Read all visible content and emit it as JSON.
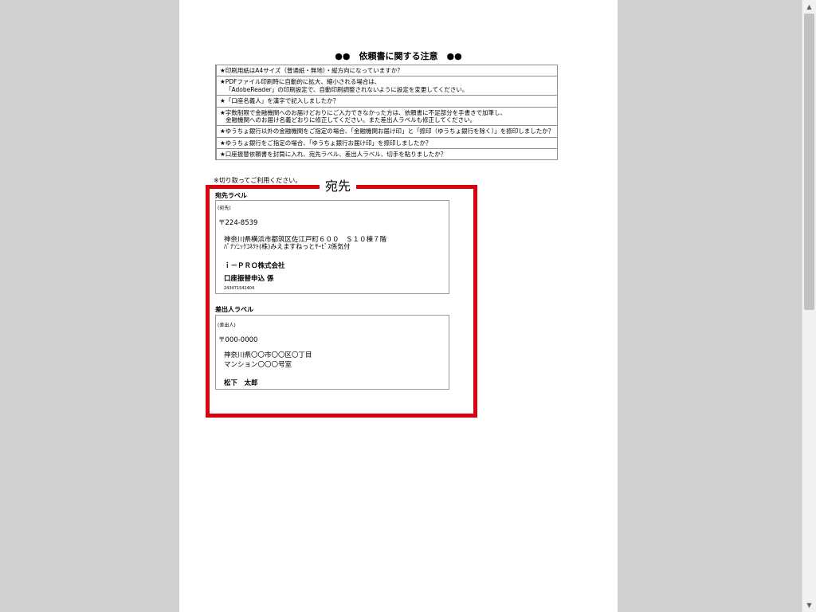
{
  "document": {
    "title": "●●　依頼書に関する注意　●●",
    "checklist": [
      [
        "★印刷用紙はA4サイズ（普通紙・無地）・縦方向になっていますか？"
      ],
      [
        "★PDFファイル印刷時に自動的に拡大、縮小される場合は、",
        "「AdobeReader」の印刷設定で、自動印刷調整されないように設定を変更してください。"
      ],
      [
        "★「口座名義人」を漢字で記入しましたか？"
      ],
      [
        "★字数制限で金融機関へのお届けどおりにご入力できなかった方は、依頼書に不足部分を手書きで加筆し、",
        "金融機関へのお届け名義どおりに修正してください。また差出人ラベルも修正してください。"
      ],
      [
        "★ゆうちょ銀行以外の金融機関をご指定の場合、「金融機関お届け印」と「捺印（ゆうちょ銀行を除く）」を捺印しましたか？"
      ],
      [
        "★ゆうちょ銀行をご指定の場合、「ゆうちょ銀行お届け印」を捺印しましたか？"
      ],
      [
        "★口座振替依頼書を封筒に入れ、宛先ラベル、差出人ラベル、切手を貼りましたか？"
      ]
    ],
    "cut_note": "※切り取ってご利用ください。",
    "frame_title": "宛先"
  },
  "recipient_label": {
    "heading": "宛先ラベル",
    "tag": "(宛先)",
    "postal": "〒224-8539",
    "address": "神奈川県横浜市都筑区佐江戸町６００　Ｓ１０棟７階",
    "care_of": "ﾊﾟﾅｿﾆｯｸｺﾈｸﾄ(株)みえますねっとｻｰﾋﾞｽ係気付",
    "company": "ｉ－ＰＲＯ株式会社",
    "department": "口座振替申込 係",
    "code": "243471542404"
  },
  "sender_label": {
    "heading": "差出人ラベル",
    "tag": "(差出人)",
    "postal": "〒000-0000",
    "address": "神奈川県〇〇市〇〇区〇丁目",
    "building": "マンション〇〇〇号室",
    "name": "松下　太郎"
  },
  "colors": {
    "frame": "#d7000f",
    "background": "#d0d0d0"
  },
  "icons": {
    "scroll_up": "triangle-up",
    "scroll_down": "triangle-down"
  }
}
